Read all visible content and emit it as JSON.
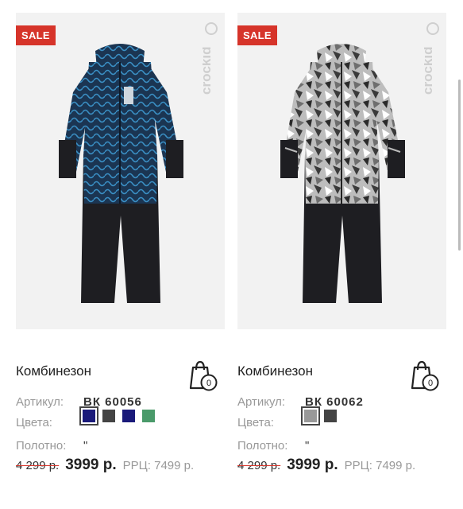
{
  "products": [
    {
      "sale_badge": "SALE",
      "brand": "crockid",
      "title": "Комбинезон",
      "cart_count": "0",
      "article_label": "Артикул:",
      "article_value": "ВК 60056",
      "colors_label": "Цвета:",
      "colors": [
        "#1a1a7a",
        "#444444",
        "#1a1a7a",
        "#4a9a6a"
      ],
      "fabric_label": "Полотно:",
      "fabric_value": "\"",
      "old_price": "4 299 р.",
      "new_price": "3999 р.",
      "rrc": "РРЦ: 7499 р.",
      "accent": "#1d5a8a"
    },
    {
      "sale_badge": "SALE",
      "brand": "crockid",
      "title": "Комбинезон",
      "cart_count": "0",
      "article_label": "Артикул:",
      "article_value": "ВК 60062",
      "colors_label": "Цвета:",
      "colors": [
        "#999999",
        "#444444"
      ],
      "fabric_label": "Полотно:",
      "fabric_value": "\"",
      "old_price": "4 299 р.",
      "new_price": "3999 р.",
      "rrc": "РРЦ: 7499 р.",
      "accent": "#8a8a8a"
    }
  ],
  "icons": {
    "cart": "shopping-bag-icon",
    "brand_logo": "crockid-logo"
  }
}
